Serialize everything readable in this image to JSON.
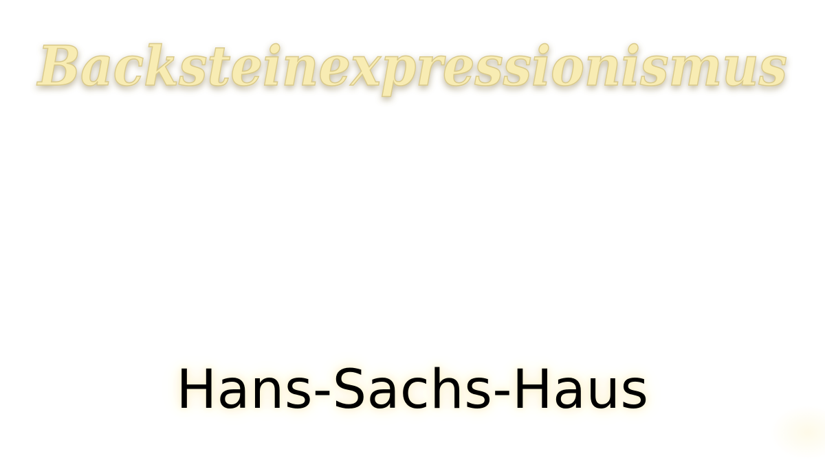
{
  "logo": {
    "text": "Backsteinexpressionismus",
    "fill_color": "#f8ecb3",
    "stroke_color": "#d9c98a",
    "shadow_color": "#8a7a4a"
  },
  "caption": {
    "text": "Hans-Sachs-Haus"
  },
  "colors": {
    "background": "#ffffff",
    "glow": "#fbf3d2",
    "caption_text": "#000000"
  }
}
